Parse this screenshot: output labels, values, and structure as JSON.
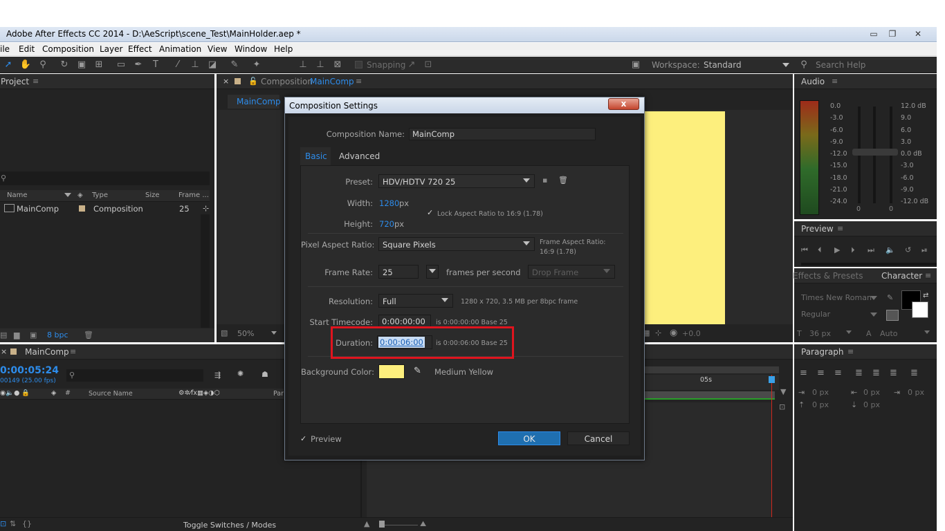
{
  "window": {
    "title": "Adobe After Effects CC 2014 - D:\\AeScript\\scene_Test\\MainHolder.aep *"
  },
  "menu": [
    "ile",
    "Edit",
    "Composition",
    "Layer",
    "Effect",
    "Animation",
    "View",
    "Window",
    "Help"
  ],
  "toolbar": {
    "snapping": "Snapping",
    "workspace_label": "Workspace:",
    "workspace_value": "Standard",
    "search_placeholder": "Search Help"
  },
  "project": {
    "title": "Project",
    "columns": [
      "Name",
      "Type",
      "Size",
      "Frame ..."
    ],
    "items": [
      {
        "name": "MainComp",
        "type": "Composition",
        "frame": "25"
      }
    ],
    "bpc": "8 bpc"
  },
  "comp_panel": {
    "tab_title": "Composition",
    "comp_name": "MainComp",
    "breadcrumb": "MainComp",
    "zoom": "50%",
    "exposure": "+0.0",
    "bg_color": "#fdef7d"
  },
  "audio": {
    "title": "Audio",
    "left_scale": [
      "0.0",
      "-3.0",
      "-6.0",
      "-9.0",
      "-12.0",
      "-15.0",
      "-18.0",
      "-21.0",
      "-24.0"
    ],
    "right_scale": [
      "12.0 dB",
      "9.0",
      "6.0",
      "3.0",
      "0.0 dB",
      "-3.0",
      "-6.0",
      "-9.0",
      "-12.0 dB"
    ],
    "zero_a": "0",
    "zero_b": "0"
  },
  "preview": {
    "title": "Preview"
  },
  "character": {
    "tab_effects": "Effects & Presets",
    "tab_character": "Character",
    "font": "Times New Roman",
    "style": "Regular",
    "size": "36 px",
    "leading": "Auto"
  },
  "paragraph": {
    "title": "Paragraph",
    "v1": "0 px",
    "v2": "0 px",
    "v3": "0 px",
    "v4": "0 px",
    "v5": "0 px"
  },
  "timeline": {
    "tab": "MainComp",
    "timecode": "0:00:05:24",
    "frames": "00149 (25.00 fps)",
    "col_source": "Source Name",
    "col_par": "Par",
    "ruler_mark": "05s",
    "toggle": "Toggle Switches / Modes"
  },
  "dialog": {
    "title": "Composition Settings",
    "close": "x",
    "comp_name_label": "Composition Name:",
    "comp_name": "MainComp",
    "tabs": [
      "Basic",
      "Advanced"
    ],
    "preset_label": "Preset:",
    "preset": "HDV/HDTV 720 25",
    "width_label": "Width:",
    "width": "1280",
    "height_label": "Height:",
    "height": "720",
    "px": "px",
    "lock_label": "Lock Aspect Ratio to 16:9 (1.78)",
    "par_label": "Pixel Aspect Ratio:",
    "par": "Square Pixels",
    "far_label": "Frame Aspect Ratio:",
    "far_value": "16:9 (1.78)",
    "fps_label": "Frame Rate:",
    "fps": "25",
    "fps_unit": "frames per second",
    "drop_frame": "Drop Frame",
    "res_label": "Resolution:",
    "res": "Full",
    "res_info": "1280 x 720, 3.5 MB per 8bpc frame",
    "start_label": "Start Timecode:",
    "start": "0:00:00:00",
    "start_info": "is 0:00:00:00  Base 25",
    "dur_label": "Duration:",
    "duration": "0:00:06:00",
    "dur_info": "is 0:00:06:00  Base 25",
    "bg_label": "Background Color:",
    "bg_name": "Medium Yellow",
    "bg_hex": "#fdef7d",
    "preview": "Preview",
    "ok": "OK",
    "cancel": "Cancel"
  }
}
